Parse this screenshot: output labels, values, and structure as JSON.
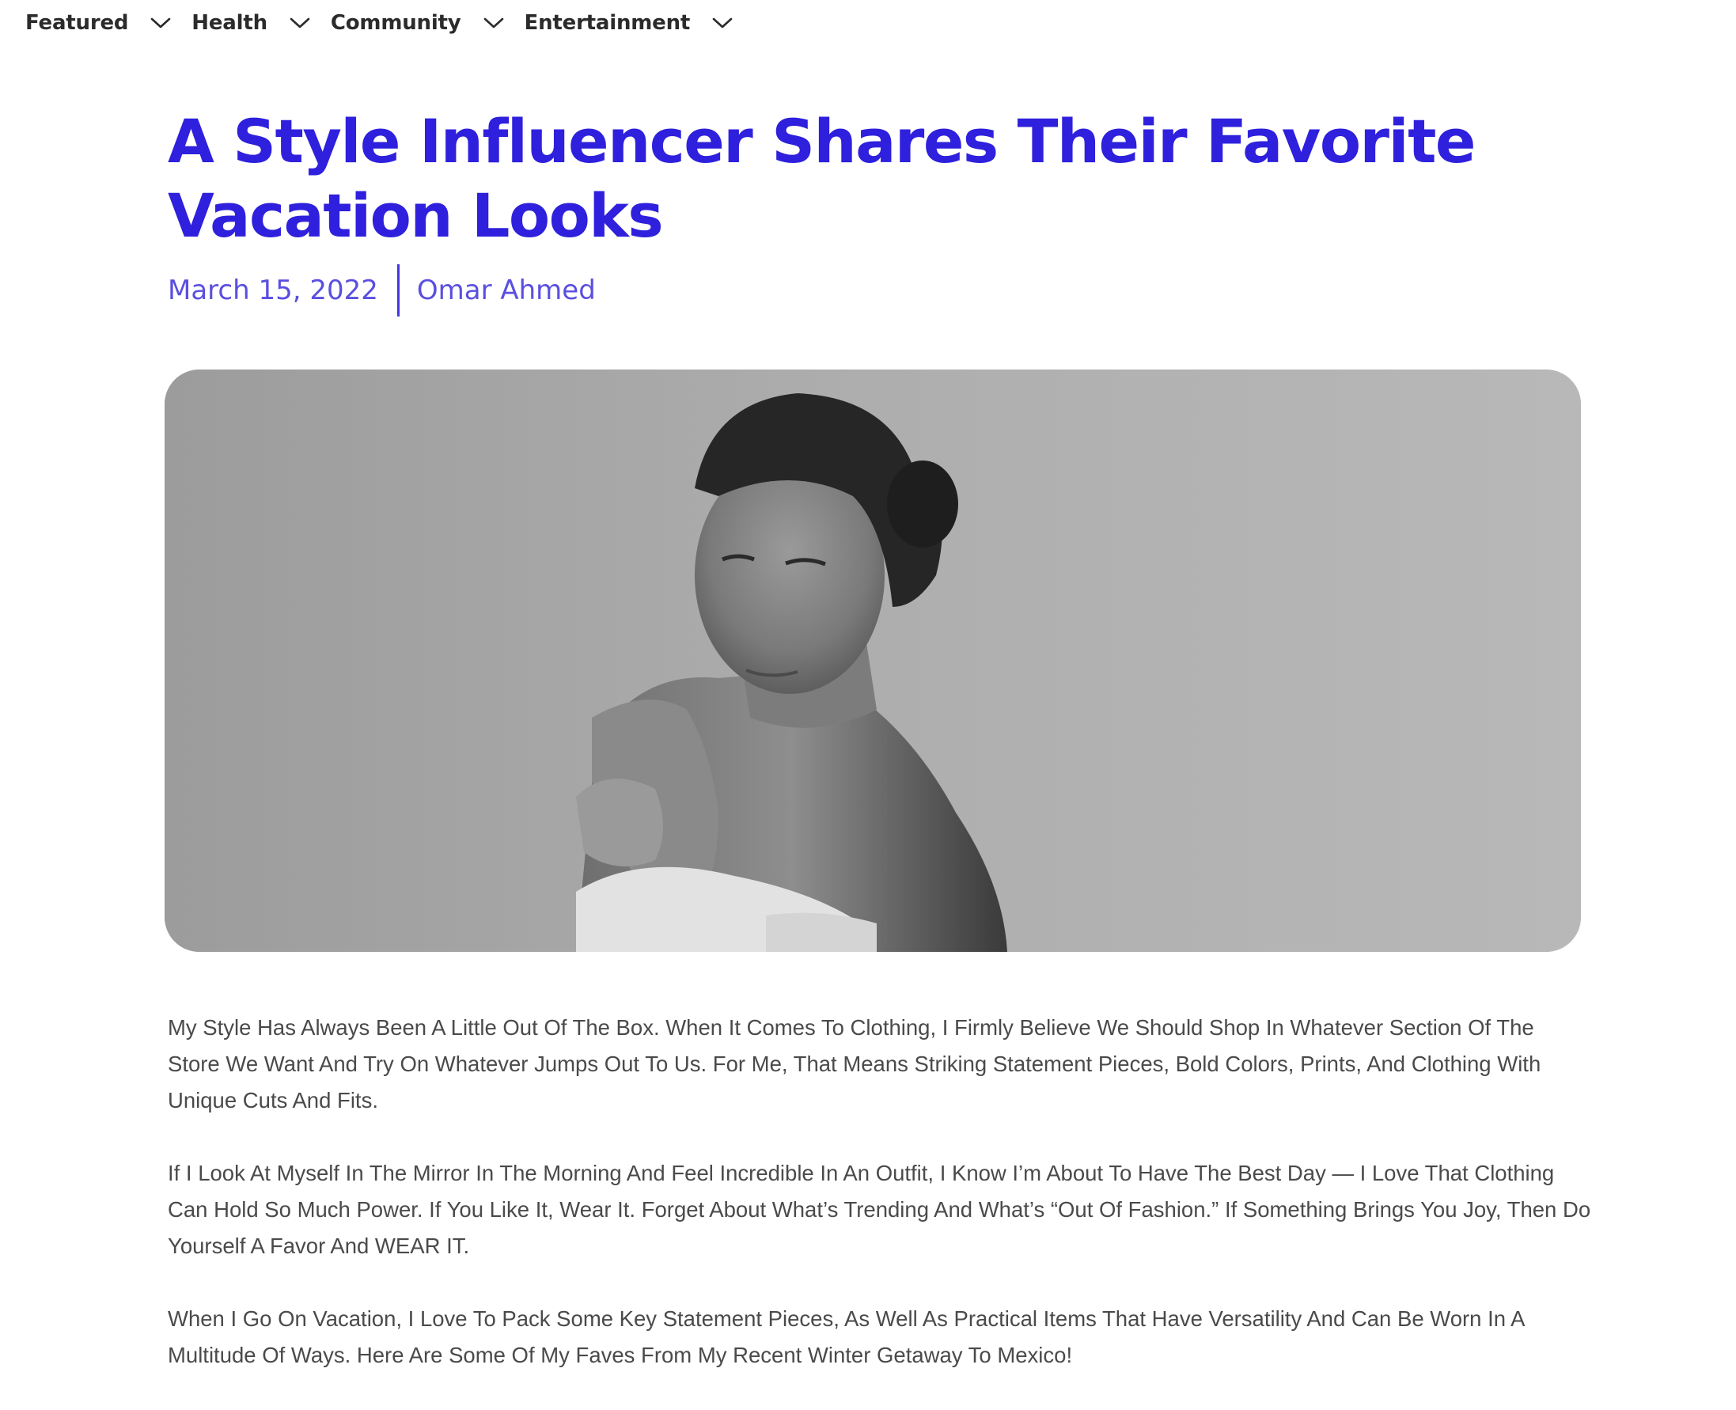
{
  "nav": {
    "items": [
      {
        "label": "Featured",
        "icon": "chevron-down-icon"
      },
      {
        "label": "Health",
        "icon": "chevron-down-icon"
      },
      {
        "label": "Community",
        "icon": "chevron-down-icon"
      },
      {
        "label": "Entertainment",
        "icon": "chevron-down-icon"
      }
    ]
  },
  "article": {
    "title": "A Style Influencer Shares Their Favorite Vacation Looks",
    "date": "March 15, 2022",
    "author": "Omar Ahmed",
    "hero_image": {
      "subject": "black-and-white portrait photo",
      "icon": "hero-photo"
    },
    "paragraphs": [
      "My Style Has Always Been A Little Out Of The Box. When It Comes To Clothing, I Firmly Believe We Should Shop In Whatever Section Of The Store We Want And Try On Whatever Jumps Out To Us. For Me, That Means Striking Statement Pieces, Bold Colors, Prints, And Clothing With Unique Cuts And Fits.",
      "If I Look At Myself In The Mirror In The Morning And Feel Incredible In An Outfit, I Know I’m About To Have The Best Day — I Love That Clothing Can Hold So Much Power. If You Like It, Wear It. Forget About What’s Trending And What’s “Out Of Fashion.” If Something Brings You Joy, Then Do Yourself A Favor And WEAR IT.",
      "When I Go On Vacation, I Love To Pack Some Key Statement Pieces, As Well As Practical Items That Have Versatility And Can Be Worn In A Multitude Of Ways. Here Are Some Of My Faves From My Recent Winter Getaway To Mexico!"
    ]
  },
  "colors": {
    "title": "#2e20dc",
    "meta": "#5a4fe0",
    "nav_text": "#2b2b2b",
    "body_text": "#4a4a4a"
  }
}
